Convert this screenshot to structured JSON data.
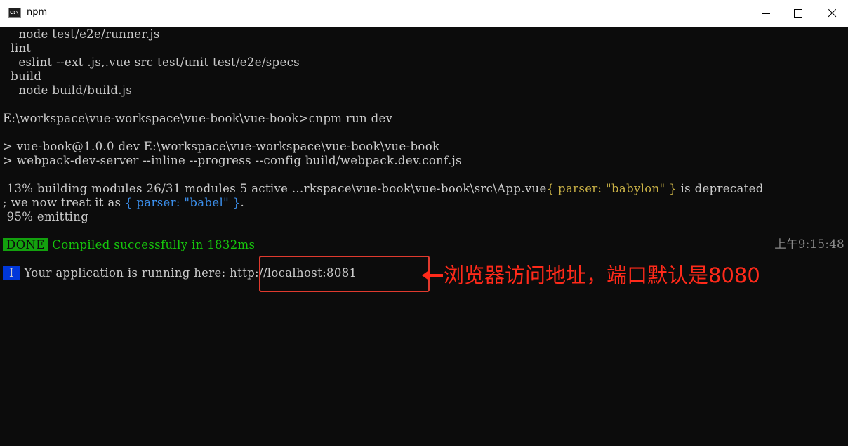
{
  "window": {
    "title": "npm",
    "icon_text": "C:\\"
  },
  "console": {
    "lines": [
      "    node test/e2e/runner.js",
      "  lint",
      "    eslint --ext .js,.vue src test/unit test/e2e/specs",
      "  build",
      "    node build/build.js",
      "E:\\workspace\\vue-workspace\\vue-book\\vue-book>cnpm run dev",
      "> vue-book@1.0.0 dev E:\\workspace\\vue-workspace\\vue-book\\vue-book",
      "> webpack-dev-server --inline --progress --config build/webpack.dev.conf.js"
    ],
    "building": {
      "prefix": " 13% building modules 26/31 modules 5 active ...rkspace\\vue-book\\vue-book\\src\\App.vue",
      "yellow_part": "{ parser: \"babylon\" }",
      "suffix": " is deprecated"
    },
    "deprecation": {
      "prefix": "; we now treat it as ",
      "blue_part": "{ parser: \"babel\" }",
      "suffix": "."
    },
    "emitting": " 95% emitting",
    "done": {
      "badge": "DONE",
      "message": " Compiled successfully in 1832ms",
      "time": "上午9:15:48"
    },
    "info": {
      "badge": "I",
      "message": " Your application is running here: ",
      "url": "http://localhost:8081"
    }
  },
  "annotation": {
    "text": "浏览器访问地址，端口默认是8080",
    "color": "#ff2a1a"
  },
  "colors": {
    "terminal_bg": "#0c0c0c",
    "terminal_text": "#cccccc",
    "done_badge": "#13a10e",
    "info_badge": "#0037da",
    "highlight": "#e03a2e"
  }
}
